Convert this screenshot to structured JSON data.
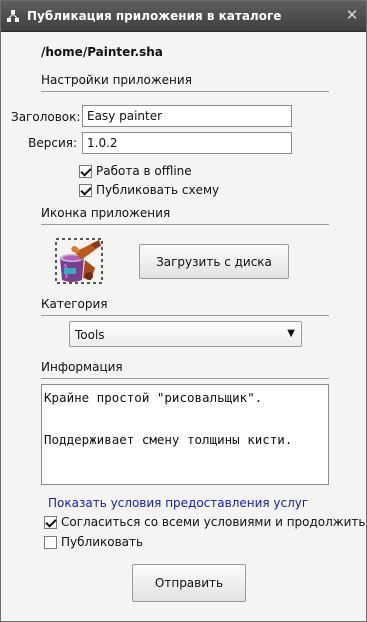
{
  "window": {
    "title": "Публикация приложения в каталоге",
    "close_glyph": "✕"
  },
  "app_path": "/home/Painter.sha",
  "settings_section": {
    "heading": "Настройки приложения",
    "title_field": {
      "label": "Заголовок:",
      "value": "Easy painter"
    },
    "version_field": {
      "label": "Версия:",
      "value": "1.0.2"
    },
    "offline_checkbox": {
      "label": "Работа в offline",
      "checked": true
    },
    "publish_scheme_checkbox": {
      "label": "Публиковать схему",
      "checked": true
    }
  },
  "icon_section": {
    "heading": "Иконка приложения",
    "icon_name": "paint-bucket-icon",
    "upload_button_label": "Загрузить с диска"
  },
  "category_section": {
    "heading": "Категория",
    "selected": "Tools",
    "arrow_glyph": "▼"
  },
  "info_section": {
    "heading": "Информация",
    "text": "Крайне простой \"рисовальщик\".\n\nПоддерживает смену толщины кисти."
  },
  "terms_link": "Показать условия предоставления услуг",
  "agree_checkbox": {
    "label": "Согласиться со всеми условиями и продолжить",
    "checked": true
  },
  "publish_checkbox": {
    "label": "Публиковать",
    "checked": false
  },
  "submit_button_label": "Отправить",
  "colors": {
    "titlebar": "#4a4a4a",
    "link": "#1a1ab8",
    "background": "#f4f4f2"
  }
}
